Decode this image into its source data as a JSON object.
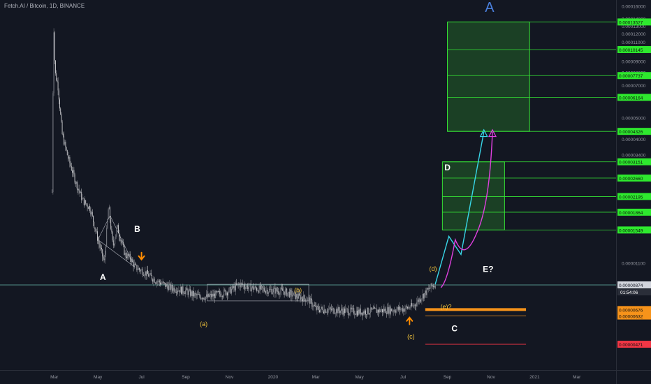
{
  "header": {
    "symbol": "Fetch.AI / Bitcoin, 1D, BINANCE"
  },
  "colors": {
    "background": "#131722",
    "candle_up": "#8a8d94",
    "candle_down": "#c8c9cc",
    "price_line": "#5fa89c",
    "zone_fill": "rgba(45,160,45,0.30)",
    "zone_line": "#35e035",
    "tag_green": "#2ee82e",
    "tag_orange": "#f7931a",
    "tag_red": "#f23645",
    "cyan_path": "#39d7e8",
    "magenta_path": "#e040e0",
    "arrow": "#ff8c00"
  },
  "chart_data": {
    "type": "candlestick",
    "symbol": "Fetch.AI / Bitcoin",
    "timeframe": "1D",
    "exchange": "BINANCE",
    "y_scale": "log",
    "ylim": [
      3.6e-06,
      0.00017
    ],
    "y_axis_labels": [
      "0.00016000",
      "0.00014000",
      "0.00013000",
      "0.00012000",
      "0.00011000",
      "0.00009000",
      "0.00008000",
      "0.00007000",
      "0.00005000",
      "0.00004000",
      "0.00003400",
      "0.00001100"
    ],
    "x_axis_labels": [
      "Mar",
      "May",
      "Jul",
      "Sep",
      "Nov",
      "2020",
      "Mar",
      "May",
      "Jul",
      "Sep",
      "Nov",
      "2021",
      "Mar"
    ],
    "current_price_tag": {
      "price": "0.00000874",
      "countdown": "01:54:06"
    },
    "target_zones": [
      {
        "name": "upper",
        "top": "0.00013527",
        "bottom": "0.00004326",
        "levels": [
          "0.00013527",
          "0.00010145",
          "0.00007737",
          "0.00006164",
          "0.00004326"
        ]
      },
      {
        "name": "lower",
        "top": "0.00003151",
        "bottom": "0.00001549",
        "levels": [
          "0.00003151",
          "0.00002660",
          "0.00002195",
          "0.00001864",
          "0.00001549"
        ]
      }
    ],
    "support_levels": [
      {
        "price": "0.00000676",
        "color": "orange"
      },
      {
        "price": "0.00000632",
        "color": "orange"
      },
      {
        "price": "0.00000471",
        "color": "red"
      }
    ],
    "wave_labels": [
      "A",
      "B",
      "(a)",
      "(b)",
      "(c)",
      "(d)",
      "(e)?",
      "C",
      "D",
      "E?",
      "A"
    ],
    "price_path": [
      [
        "2019-02-26",
        2.3e-05
      ],
      [
        "2019-02-28",
        0.000138
      ],
      [
        "2019-03-02",
        8e-05
      ],
      [
        "2019-03-06",
        7e-05
      ],
      [
        "2019-03-12",
        4.2e-05
      ],
      [
        "2019-03-20",
        3.3e-05
      ],
      [
        "2019-04-01",
        2.5e-05
      ],
      [
        "2019-04-10",
        2.1e-05
      ],
      [
        "2019-04-20",
        1.95e-05
      ],
      [
        "2019-05-01",
        1.4e-05
      ],
      [
        "2019-05-10",
        1.1e-05
      ],
      [
        "2019-05-16",
        2e-05
      ],
      [
        "2019-05-22",
        1.3e-05
      ],
      [
        "2019-05-28",
        1.6e-05
      ],
      [
        "2019-06-08",
        1.2e-05
      ],
      [
        "2019-06-16",
        1.15e-05
      ],
      [
        "2019-06-22",
        1.05e-05
      ],
      [
        "2019-07-05",
        1e-05
      ],
      [
        "2019-07-20",
        9.2e-06
      ],
      [
        "2019-08-10",
        8.5e-06
      ],
      [
        "2019-09-01",
        8.2e-06
      ],
      [
        "2019-09-15",
        7.8e-06
      ],
      [
        "2019-10-01",
        7.7e-06
      ],
      [
        "2019-11-01",
        8.2e-06
      ],
      [
        "2019-11-15",
        8.8e-06
      ],
      [
        "2019-12-01",
        8.5e-06
      ],
      [
        "2019-12-20",
        8.3e-06
      ],
      [
        "2020-01-15",
        8.2e-06
      ],
      [
        "2020-02-01",
        7.8e-06
      ],
      [
        "2020-02-20",
        7.5e-06
      ],
      [
        "2020-03-01",
        6.8e-06
      ],
      [
        "2020-04-01",
        6.7e-06
      ],
      [
        "2020-05-01",
        6.6e-06
      ],
      [
        "2020-06-01",
        6.7e-06
      ],
      [
        "2020-07-01",
        6.8e-06
      ],
      [
        "2020-07-15",
        7e-06
      ],
      [
        "2020-07-28",
        7.8e-06
      ],
      [
        "2020-08-10",
        8.6e-06
      ],
      [
        "2020-08-15",
        8.8e-06
      ]
    ]
  }
}
